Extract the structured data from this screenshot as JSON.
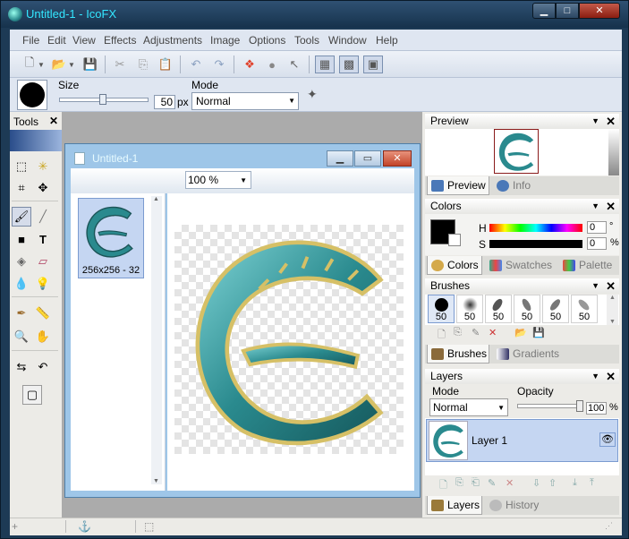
{
  "window": {
    "title": "Untitled-1 - IcoFX",
    "controls": {
      "minimize": "▁",
      "maximize": "□",
      "close": "✕"
    }
  },
  "menu": [
    "File",
    "Edit",
    "View",
    "Effects",
    "Adjustments",
    "Image",
    "Options",
    "Tools",
    "Window",
    "Help"
  ],
  "options_bar": {
    "size_label": "Size",
    "size_value": "50",
    "size_unit": "px",
    "mode_label": "Mode",
    "mode_value": "Normal"
  },
  "tools_panel": {
    "title": "Tools"
  },
  "document": {
    "title": "Untitled-1",
    "zoom": "100 %",
    "thumbnail_label": "256x256 - 32"
  },
  "preview_panel": {
    "title": "Preview",
    "tabs": [
      "Preview",
      "Info"
    ]
  },
  "colors_panel": {
    "title": "Colors",
    "h_label": "H",
    "h_value": "0",
    "h_unit": "°",
    "s_label": "S",
    "s_value": "0",
    "s_unit": "%",
    "tabs": [
      "Colors",
      "Swatches",
      "Palette"
    ],
    "primary_color": "#000000"
  },
  "brushes_panel": {
    "title": "Brushes",
    "sizes": [
      "50",
      "50",
      "50",
      "50",
      "50",
      "50"
    ],
    "tabs": [
      "Brushes",
      "Gradients"
    ]
  },
  "layers_panel": {
    "title": "Layers",
    "mode_label": "Mode",
    "mode_value": "Normal",
    "opacity_label": "Opacity",
    "opacity_value": "100",
    "opacity_unit": "%",
    "layer_name": "Layer 1",
    "tabs": [
      "Layers",
      "History"
    ]
  },
  "colors": {
    "accent_title": "#33e6ff",
    "icon_teal": "#2a8a8e",
    "selection": "#c5d6f2"
  }
}
